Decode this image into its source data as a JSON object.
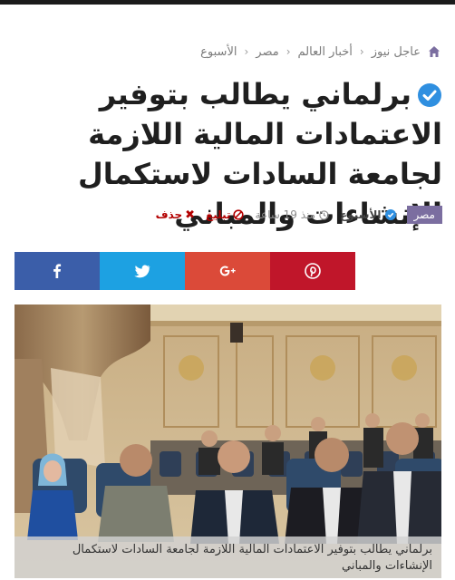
{
  "breadcrumb": {
    "items": [
      "عاجل نيوز",
      "أخبار العالم",
      "مصر",
      "الأسبوع"
    ]
  },
  "article": {
    "title": "برلماني يطالب بتوفير الاعتمادات المالية اللازمة لجامعة السادات لاستكمال الإنشاءات والمباني",
    "category": "مصر",
    "author": "الأسبوع",
    "time": "منذ 19 ساعة",
    "report_label": "تبليغ",
    "delete_label": "حذف",
    "photo_caption": "برلماني يطالب بتوفير الاعتمادات المالية اللازمة لجامعة السادات لاستكمال الإنشاءات والمباني"
  },
  "share": {
    "buttons": [
      {
        "name": "facebook",
        "icon": "facebook-icon",
        "color": "#3b5ea9"
      },
      {
        "name": "twitter",
        "icon": "twitter-icon",
        "color": "#1da1e2"
      },
      {
        "name": "google-plus",
        "icon": "google-plus-icon",
        "color": "#db4a39"
      },
      {
        "name": "pinterest",
        "icon": "pinterest-icon",
        "color": "#c0162a"
      }
    ]
  },
  "colors": {
    "category_badge": "#7b6ea0",
    "verified_blue": "#2f8fe0",
    "danger_red": "#b30000"
  }
}
